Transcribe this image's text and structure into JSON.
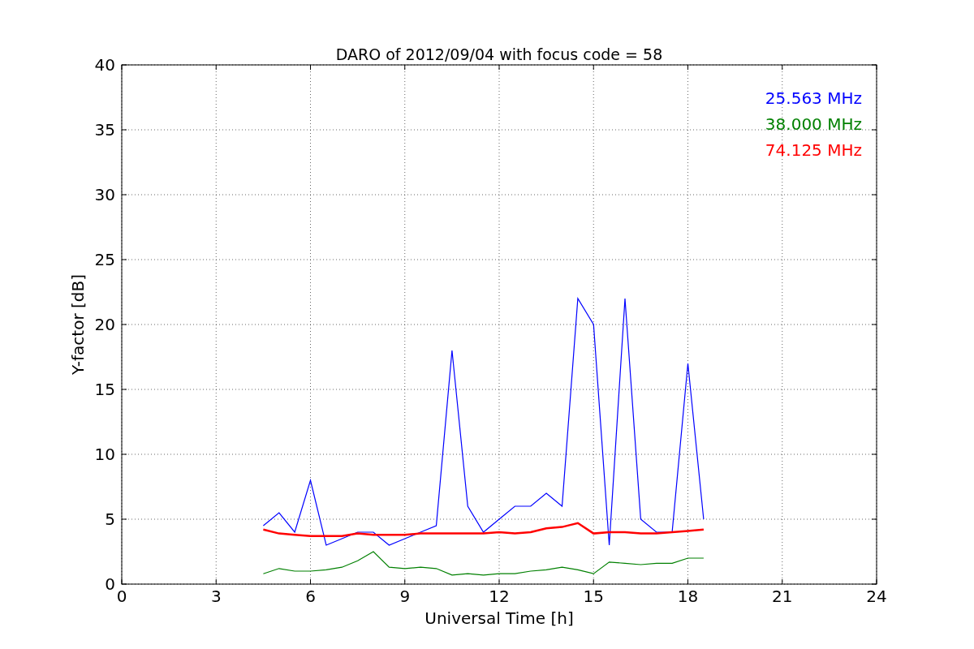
{
  "chart_data": {
    "type": "line",
    "title": "DARO of 2012/09/04 with focus code = 58",
    "xlabel": "Universal Time [h]",
    "ylabel": "Y-factor [dB]",
    "x": [
      4.5,
      5,
      5.5,
      6,
      6.5,
      7,
      7.5,
      8,
      8.5,
      9,
      9.5,
      10,
      10.5,
      11,
      11.5,
      12,
      12.5,
      13,
      13.5,
      14,
      14.5,
      15,
      15.5,
      16,
      16.5,
      17,
      17.5,
      18,
      18.5
    ],
    "series": [
      {
        "name": "25.563 MHz",
        "color": "#0000ff",
        "values": [
          4.5,
          5.5,
          4,
          8,
          3,
          3.5,
          4,
          4,
          3,
          3.5,
          4,
          4.5,
          18,
          6,
          4,
          5,
          6,
          6,
          7,
          6,
          22,
          20,
          3,
          22,
          5,
          4,
          4,
          17,
          5
        ]
      },
      {
        "name": "38.000 MHz",
        "color": "#008000",
        "values": [
          0.8,
          1.2,
          1,
          1,
          1.1,
          1.3,
          1.8,
          2.5,
          1.3,
          1.2,
          1.3,
          1.2,
          0.7,
          0.8,
          0.7,
          0.8,
          0.8,
          1,
          1.1,
          1.3,
          1.1,
          0.8,
          1.7,
          1.6,
          1.5,
          1.6,
          1.6,
          2,
          2
        ]
      },
      {
        "name": "74.125 MHz",
        "color": "#ff0000",
        "values": [
          4.2,
          3.9,
          3.8,
          3.7,
          3.7,
          3.7,
          3.9,
          3.8,
          3.8,
          3.8,
          3.9,
          3.9,
          3.9,
          3.9,
          3.9,
          4,
          3.9,
          4,
          4.3,
          4.4,
          4.7,
          3.9,
          4,
          4,
          3.9,
          3.9,
          4,
          4.1,
          4.2
        ]
      }
    ],
    "xlim": [
      0,
      24
    ],
    "ylim": [
      0,
      40
    ],
    "xticks": [
      0,
      3,
      6,
      9,
      12,
      15,
      18,
      21,
      24
    ],
    "yticks": [
      0,
      5,
      10,
      15,
      20,
      25,
      30,
      35,
      40
    ],
    "grid": true
  }
}
